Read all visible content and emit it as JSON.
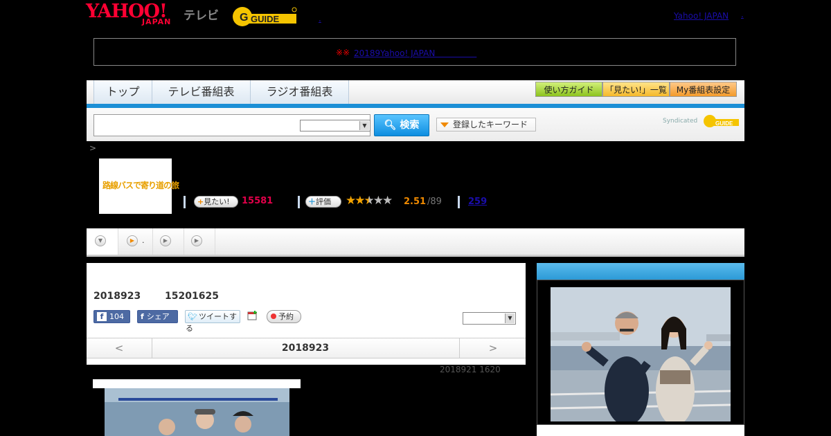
{
  "header": {
    "logo_text": "YAHOO!",
    "logo_sub": "JAPAN",
    "tv_label": "テレビ",
    "gguide_label": "G-GUIDE",
    "yahoo_japan_link": "Yahoo! JAPAN",
    "dot_link": ".",
    "dot_link2": "."
  },
  "notice": {
    "marks": "※※",
    "link_text": "20189Yahoo! JAPAN　　　　　"
  },
  "nav": {
    "tabs": [
      "トップ",
      "テレビ番組表",
      "ラジオ番組表"
    ],
    "guide_button": "使い方ガイド",
    "want_list_button": "「見たい!」一覧",
    "my_schedule_button": "My番組表設定"
  },
  "search": {
    "input_value": "",
    "select_value": "",
    "button_label": "検索",
    "keyword_button": "登録したキーワード",
    "syndicated_label": "Syndicated"
  },
  "breadcrumb": ">",
  "program": {
    "thumb_title": "路線バスで寄り道の旅",
    "want_label": "見たい!",
    "want_count": "15581",
    "rate_label": "評価",
    "rating": "2.51",
    "rating_count": "/89",
    "stars_filled": 2.5,
    "review_count": "259"
  },
  "strip": {
    "items": [
      "",
      ".",
      "",
      ""
    ]
  },
  "main": {
    "date": "2018923",
    "time": "15201625",
    "fb_like_count": "104",
    "fb_share": "シェア",
    "tweet": "ツイートする",
    "reserve": "予約",
    "day_select": "",
    "prev": "<",
    "current_date": "2018923",
    "next": ">",
    "original_air": "2018921  1620"
  },
  "colors": {
    "accent_blue": "#1b8fd6",
    "yahoo_red": "#ff0033",
    "want_pink": "#e2004a",
    "rating_orange": "#f08a00"
  }
}
